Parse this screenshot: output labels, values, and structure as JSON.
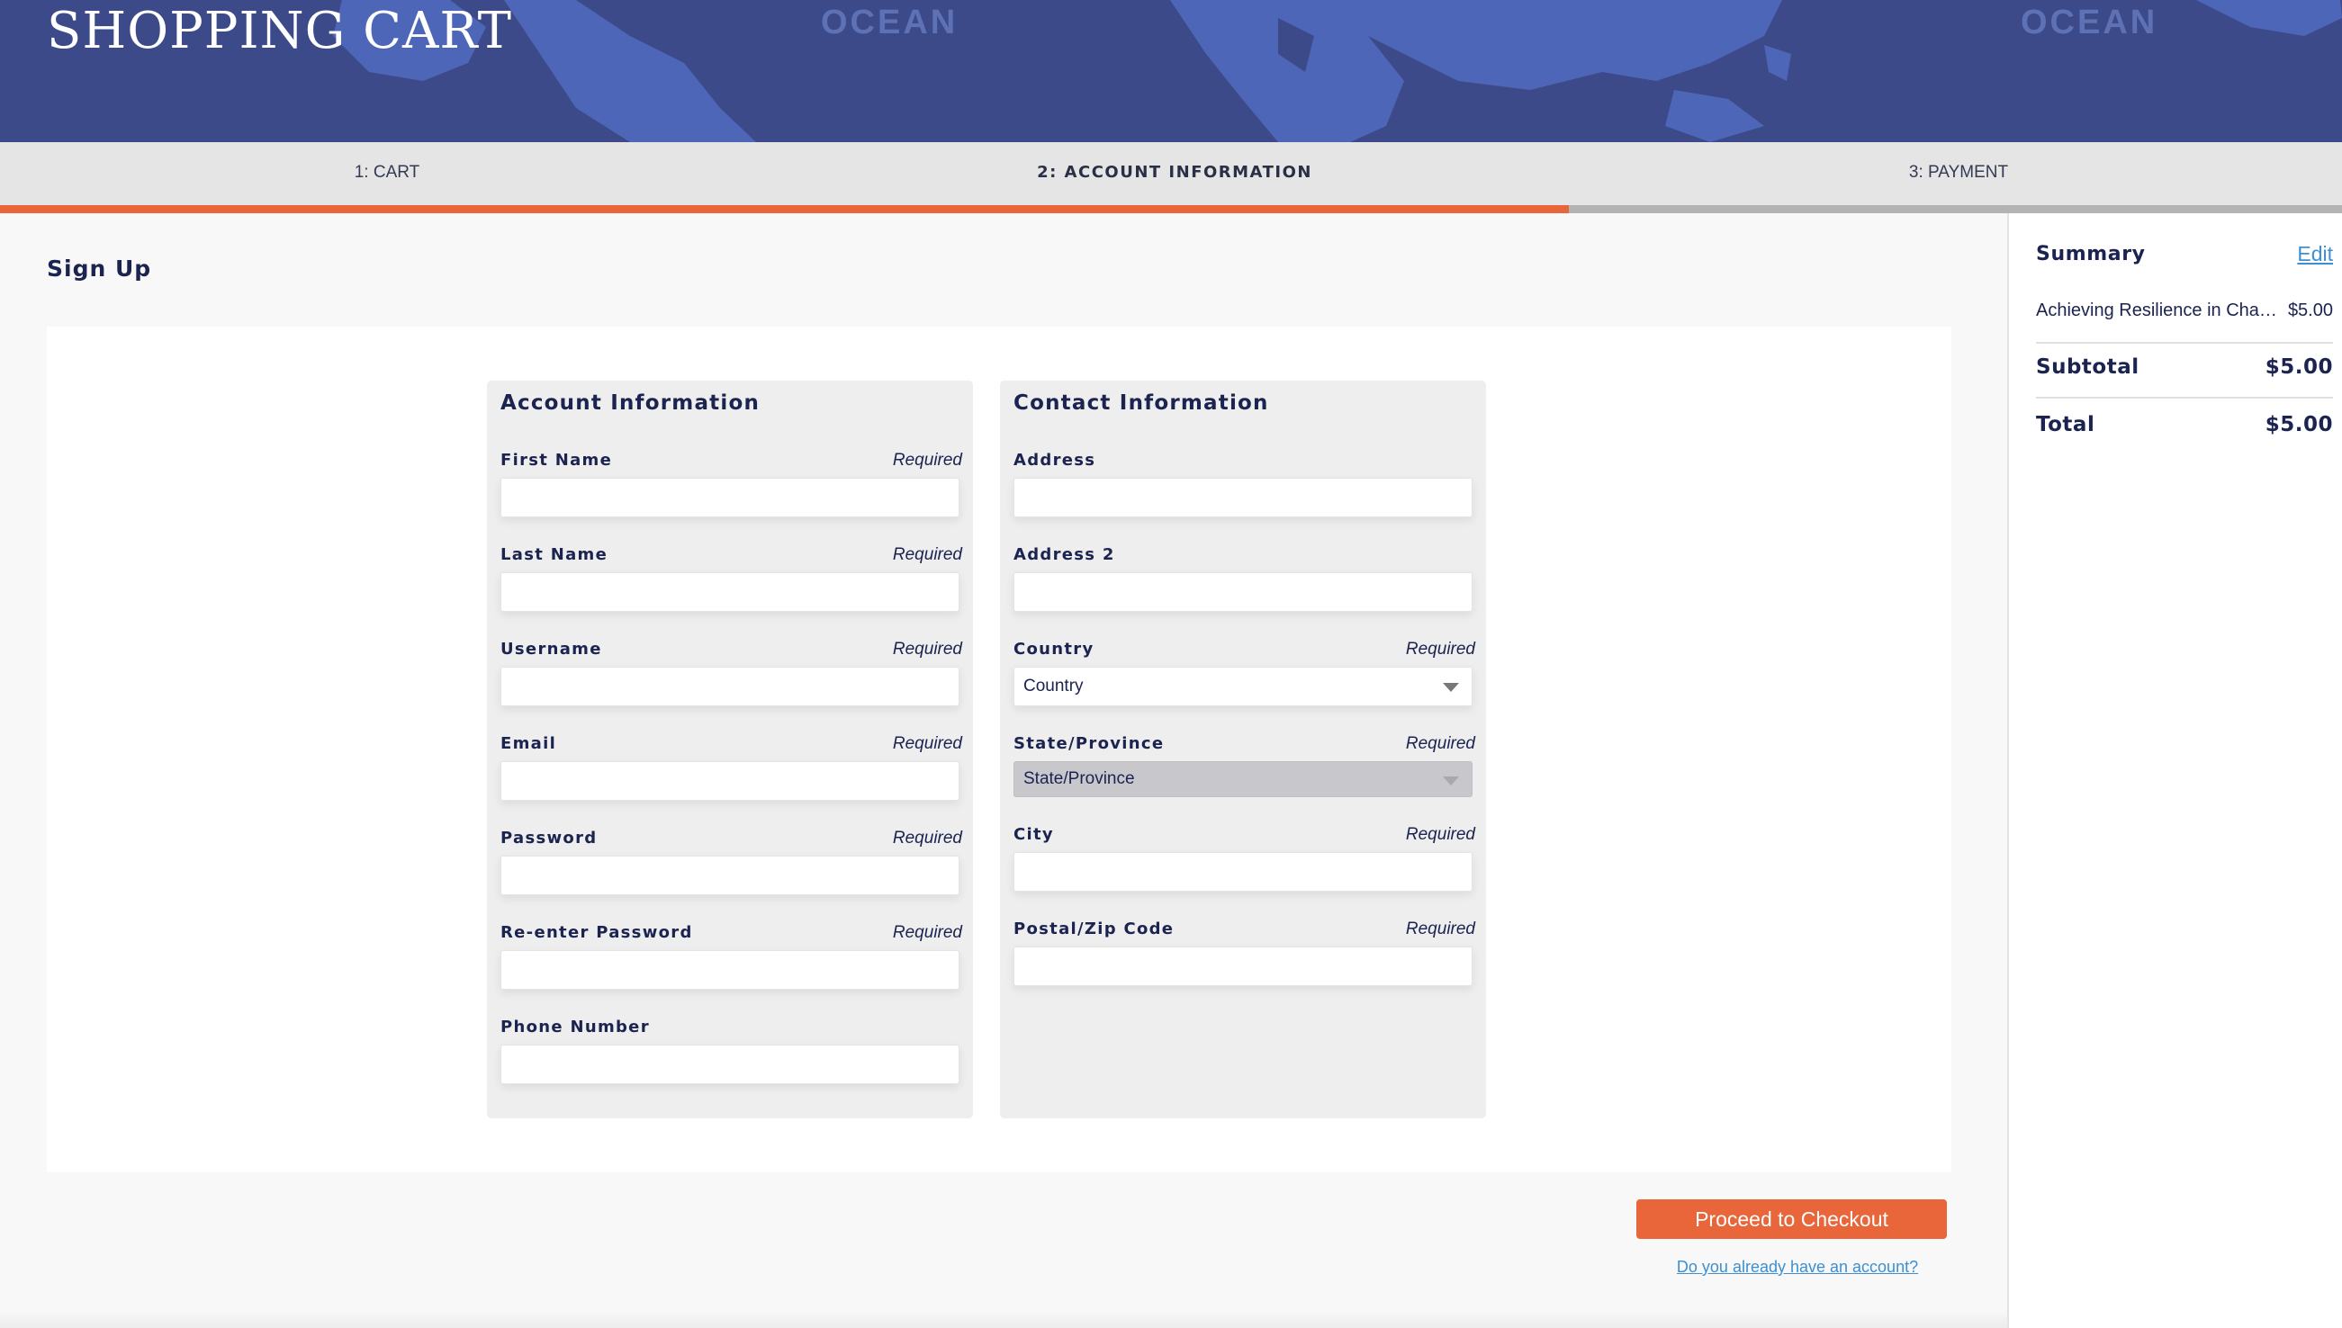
{
  "header": {
    "title": "SHOPPING CART",
    "map_labels": [
      "OCEAN",
      "OCEAN"
    ]
  },
  "steps": {
    "items": [
      {
        "label": "1: CART",
        "active": false
      },
      {
        "label": "2: ACCOUNT INFORMATION",
        "active": true
      },
      {
        "label": "3: PAYMENT",
        "active": false
      }
    ],
    "progress": 0.67
  },
  "page": {
    "heading": "Sign Up"
  },
  "account_panel": {
    "title": "Account Information",
    "fields": [
      {
        "label": "First Name",
        "required": "Required",
        "value": ""
      },
      {
        "label": "Last Name",
        "required": "Required",
        "value": ""
      },
      {
        "label": "Username",
        "required": "Required",
        "value": ""
      },
      {
        "label": "Email",
        "required": "Required",
        "value": ""
      },
      {
        "label": "Password",
        "required": "Required",
        "value": ""
      },
      {
        "label": "Re-enter Password",
        "required": "Required",
        "value": ""
      },
      {
        "label": "Phone Number",
        "value": ""
      }
    ]
  },
  "contact_panel": {
    "title": "Contact Information",
    "address": {
      "label": "Address",
      "value": ""
    },
    "address2": {
      "label": "Address 2",
      "value": ""
    },
    "country": {
      "label": "Country",
      "required": "Required",
      "selected": "Country"
    },
    "state": {
      "label": "State/Province",
      "required": "Required",
      "selected": "State/Province",
      "disabled": true
    },
    "city": {
      "label": "City",
      "required": "Required",
      "value": ""
    },
    "postal": {
      "label": "Postal/Zip Code",
      "required": "Required",
      "value": ""
    }
  },
  "actions": {
    "checkout_label": "Proceed to Checkout",
    "login_link": "Do you already have an account?"
  },
  "summary": {
    "title": "Summary",
    "edit_label": "Edit",
    "item_name": "Achieving Resilience in Changing Times",
    "item_price": "$5.00",
    "subtotal_label": "Subtotal",
    "subtotal_value": "$5.00",
    "total_label": "Total",
    "total_value": "$5.00"
  },
  "colors": {
    "banner": "#3d4a8a",
    "accent": "#e8663a",
    "link": "#3d8fd1",
    "text": "#1b2350"
  }
}
